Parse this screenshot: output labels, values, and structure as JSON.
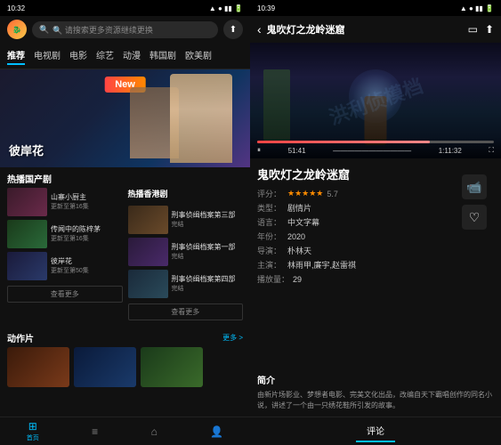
{
  "left": {
    "statusBar": {
      "time": "10:32",
      "icons": "signal wifi battery"
    },
    "search": {
      "placeholder": "🔍 请搜索更多资源继续更换"
    },
    "navTabs": [
      {
        "label": "推荐",
        "active": true
      },
      {
        "label": "电视剧",
        "active": false
      },
      {
        "label": "电影",
        "active": false
      },
      {
        "label": "综艺",
        "active": false
      },
      {
        "label": "动漫",
        "active": false
      },
      {
        "label": "韩国剧",
        "active": false
      },
      {
        "label": "欧美剧",
        "active": false
      }
    ],
    "hero": {
      "title": "彼岸花",
      "newBadge": "New"
    },
    "domesticDrama": {
      "sectionTitle": "热播国产剧",
      "seeMore": "查看更多",
      "items": [
        {
          "name": "山寨小厨主",
          "update": "更新至第16集"
        },
        {
          "name": "传闻中的陈梓茅",
          "update": "更新至第16集"
        },
        {
          "name": "彼岸花",
          "update": "更新至第50集"
        }
      ]
    },
    "hkDrama": {
      "sectionTitle": "热播香港剧",
      "seeMore": "查看更多",
      "items": [
        {
          "name": "刑事侦缉档案第三部",
          "update": "完结"
        },
        {
          "name": "刑事侦缉档案第一部",
          "update": "完结"
        },
        {
          "name": "刑事侦缉档案第四部",
          "update": "完结"
        }
      ]
    },
    "actionSection": {
      "sectionTitle": "动作片",
      "seeMore": "更多 >"
    },
    "bottomNav": [
      {
        "label": "首页",
        "icon": "⊞",
        "active": true
      },
      {
        "label": "",
        "icon": "≡",
        "active": false
      },
      {
        "label": "",
        "icon": "⌂",
        "active": false
      },
      {
        "label": "",
        "icon": "👤",
        "active": false
      }
    ]
  },
  "right": {
    "statusBar": {
      "time": "10:39",
      "icons": "signal wifi battery"
    },
    "header": {
      "title": "鬼吹灯之龙岭迷窟",
      "backLabel": "‹"
    },
    "player": {
      "currentTime": "51:41",
      "totalTime": "1:11:32",
      "progressPercent": 73,
      "watermark": "洪利侦模档"
    },
    "movieTitle": "鬼吹灯之龙岭迷窟",
    "rating": {
      "label": "评分：",
      "stars": "★★★★★",
      "score": "5.7"
    },
    "genre": {
      "label": "类型：",
      "value": "剧情片"
    },
    "language": {
      "label": "语言：",
      "value": "中文字幕"
    },
    "year": {
      "label": "年份：",
      "value": "2020"
    },
    "director": {
      "label": "导演：",
      "value": "朴林天"
    },
    "cast": {
      "label": "主演：",
      "value": "林雨甲,廉宇,赵雷祺"
    },
    "playCount": {
      "label": "播放量：",
      "value": "29"
    },
    "intro": {
      "title": "简介",
      "text": "由新片场影业、梦想者电影、完美文化出品，改编自天下霸唱创作的同名小说，讲述了一个由一只绣花鞋所引发的故事。"
    },
    "commentTab": "评论",
    "actionIcons": {
      "video": "📹",
      "heart": "♡"
    }
  }
}
